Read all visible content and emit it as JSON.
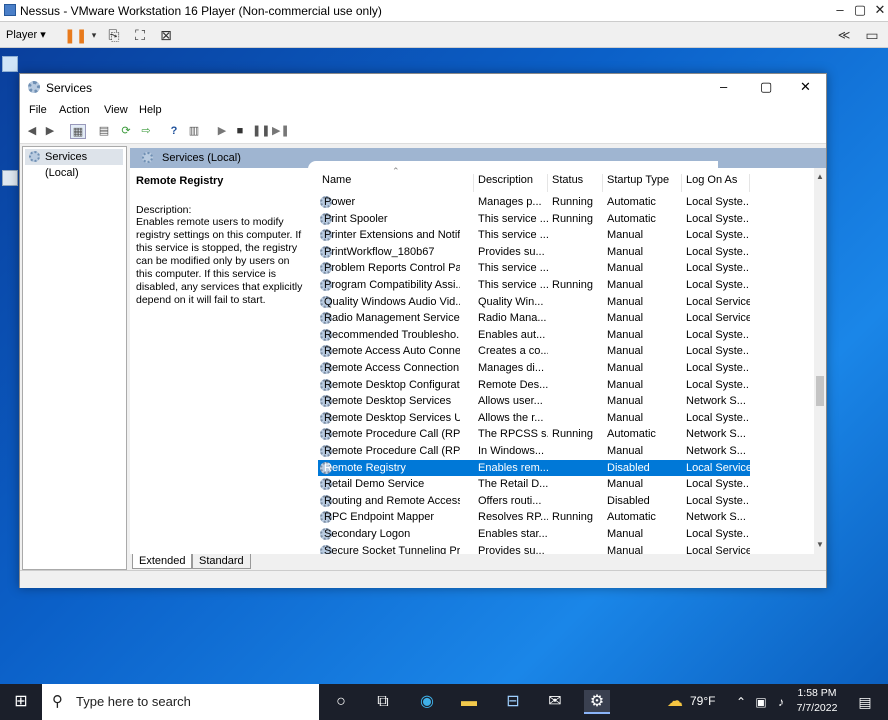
{
  "vm": {
    "title": "Nessus - VMware Workstation 16 Player (Non-commercial use only)",
    "player_menu": "Player",
    "collapse": "≪"
  },
  "services_window": {
    "title": "Services",
    "menu": [
      "File",
      "Action",
      "View",
      "Help"
    ],
    "tree_item": "Services (Local)",
    "header": "Services (Local)",
    "desc_name": "Remote Registry",
    "desc_label": "Description:",
    "desc_text": "Enables remote users to modify registry settings on this computer. If this service is stopped, the registry can be modified only by users on this computer. If this service is disabled, any services that explicitly depend on it will fail to start.",
    "columns": [
      "Name",
      "Description",
      "Status",
      "Startup Type",
      "Log On As"
    ],
    "rows": [
      [
        "Power",
        "Manages p...",
        "Running",
        "Automatic",
        "Local Syste..."
      ],
      [
        "Print Spooler",
        "This service ...",
        "Running",
        "Automatic",
        "Local Syste..."
      ],
      [
        "Printer Extensions and Notif...",
        "This service ...",
        "",
        "Manual",
        "Local Syste..."
      ],
      [
        "PrintWorkflow_180b67",
        "Provides su...",
        "",
        "Manual",
        "Local Syste..."
      ],
      [
        "Problem Reports Control Pa...",
        "This service ...",
        "",
        "Manual",
        "Local Syste..."
      ],
      [
        "Program Compatibility Assi...",
        "This service ...",
        "Running",
        "Manual",
        "Local Syste..."
      ],
      [
        "Quality Windows Audio Vid...",
        "Quality Win...",
        "",
        "Manual",
        "Local Service"
      ],
      [
        "Radio Management Service",
        "Radio Mana...",
        "",
        "Manual",
        "Local Service"
      ],
      [
        "Recommended Troublesho...",
        "Enables aut...",
        "",
        "Manual",
        "Local Syste..."
      ],
      [
        "Remote Access Auto Conne...",
        "Creates a co...",
        "",
        "Manual",
        "Local Syste..."
      ],
      [
        "Remote Access Connection...",
        "Manages di...",
        "",
        "Manual",
        "Local Syste..."
      ],
      [
        "Remote Desktop Configurat...",
        "Remote Des...",
        "",
        "Manual",
        "Local Syste..."
      ],
      [
        "Remote Desktop Services",
        "Allows user...",
        "",
        "Manual",
        "Network S..."
      ],
      [
        "Remote Desktop Services U...",
        "Allows the r...",
        "",
        "Manual",
        "Local Syste..."
      ],
      [
        "Remote Procedure Call (RPC)",
        "The RPCSS s...",
        "Running",
        "Automatic",
        "Network S..."
      ],
      [
        "Remote Procedure Call (RP...",
        "In Windows...",
        "",
        "Manual",
        "Network S..."
      ],
      [
        "Remote Registry",
        "Enables rem...",
        "",
        "Disabled",
        "Local Service"
      ],
      [
        "Retail Demo Service",
        "The Retail D...",
        "",
        "Manual",
        "Local Syste..."
      ],
      [
        "Routing and Remote Access",
        "Offers routi...",
        "",
        "Disabled",
        "Local Syste..."
      ],
      [
        "RPC Endpoint Mapper",
        "Resolves RP...",
        "Running",
        "Automatic",
        "Network S..."
      ],
      [
        "Secondary Logon",
        "Enables star...",
        "",
        "Manual",
        "Local Syste..."
      ],
      [
        "Secure Socket Tunneling Pr...",
        "Provides su...",
        "",
        "Manual",
        "Local Service"
      ]
    ],
    "selected_index": 16,
    "tabs": [
      "Extended",
      "Standard"
    ]
  },
  "taskbar": {
    "search_placeholder": "Type here to search",
    "weather": "79°F",
    "time": "1:58 PM",
    "date": "7/7/2022"
  }
}
